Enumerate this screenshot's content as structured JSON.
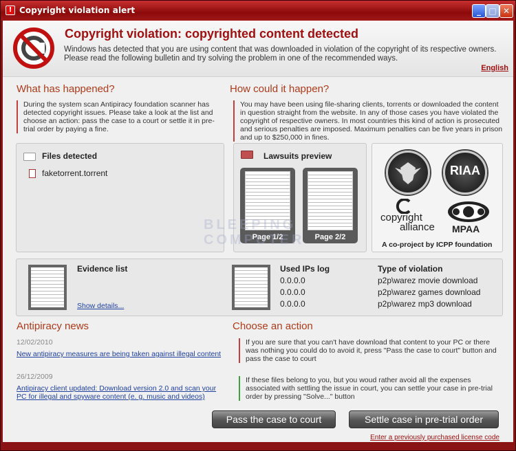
{
  "window": {
    "title": "Copyright violation alert"
  },
  "header": {
    "title": "Copyright violation: copyrighted content detected",
    "description": "Windows has detected that you are using content that was downloaded in violation of the copyright of its respective owners. Please read the following bulletin and try solving the problem in one of the recommended ways.",
    "language": "English"
  },
  "what_happened": {
    "heading": "What has happened?",
    "text": "During the system scan Antipiracy foundation scanner has detected copyright issues. Please take a look at the list and choose an action: pass the case to a court or settle it in pre-trial order by paying a fine."
  },
  "how_happened": {
    "heading": "How could it happen?",
    "text": "You may have been using file-sharing clients, torrents or downloaded the content in question straight from the website. In any of those cases you have violated the copyright of respective owners. In most countries this kind of action is prosecuted and serious penalties are imposed. Maximum penalties can be five years in prison and up to $250,000 in fines."
  },
  "files_detected": {
    "title": "Files detected",
    "files": [
      "faketorrent.torrent"
    ]
  },
  "lawsuits": {
    "title": "Lawsuits preview",
    "pages": [
      "Page 1/2",
      "Page 2/2"
    ]
  },
  "logos": {
    "riaa": "RIAA",
    "copyright_alliance": [
      "copyright",
      "alliance"
    ],
    "mpaa": "MPAA",
    "caption": "A co-project by ICPP foundation"
  },
  "watermark": [
    "BLEEPING",
    "COMPUTER"
  ],
  "evidence": {
    "title": "Evidence list",
    "show_details": "Show details...",
    "ip_header": "Used IPs log",
    "type_header": "Type of violation",
    "rows": [
      {
        "ip": "0.0.0.0",
        "type": "p2p\\warez movie download"
      },
      {
        "ip": "0.0.0.0",
        "type": "p2p\\warez games download"
      },
      {
        "ip": "0.0.0.0",
        "type": "p2p\\warez mp3 download"
      }
    ]
  },
  "news": {
    "heading": "Antipiracy news",
    "items": [
      {
        "date": "12/02/2010",
        "title": "New antipiracy measures are being taken against illegal content"
      },
      {
        "date": "26/12/2009",
        "title": "Antipiracy client updated: Download version 2.0 and scan your PC for illegal and spyware content (e. g. music and videos)"
      }
    ]
  },
  "actions": {
    "heading": "Choose an action",
    "court_text": "If you are sure that you can't have download that content to your PC or there was nothing you could do to avoid it, press \"Pass the case to court\" button and pass the case to court",
    "settle_text": "If these files belong to you, but you woud rather avoid all the expenses associated with settling the issue in court, you can settle your case in pre-trial order by pressing \"Solve...\" button",
    "court_button": "Pass the case to court",
    "settle_button": "Settle case in pre-trial order",
    "license_link": "Enter a previously purchased license code"
  },
  "colors": {
    "frame": "#8a1414",
    "accent": "#a01010",
    "heading": "#b03a1a",
    "link": "#2040a0"
  }
}
